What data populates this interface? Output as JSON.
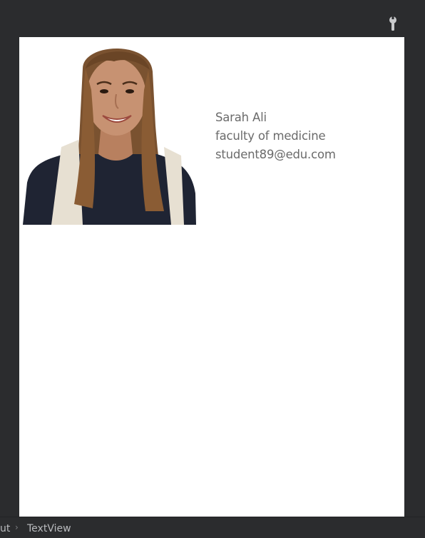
{
  "toolbar": {
    "icon": "wrench-icon"
  },
  "profile": {
    "photo_icon": "student-photo",
    "name": "Sarah Ali",
    "faculty": "faculty of medicine",
    "email": "student89@edu.com"
  },
  "breadcrumb": {
    "previous_label": "ut",
    "separator": "›",
    "current_label": "TextView"
  },
  "colors": {
    "background": "#2b2c2e",
    "canvas": "#ffffff",
    "text": "#6b6b6b",
    "hair": "#7a5230",
    "skin": "#c79272",
    "shirt": "#1f2433",
    "backpack_strap": "#e7e0d2"
  }
}
